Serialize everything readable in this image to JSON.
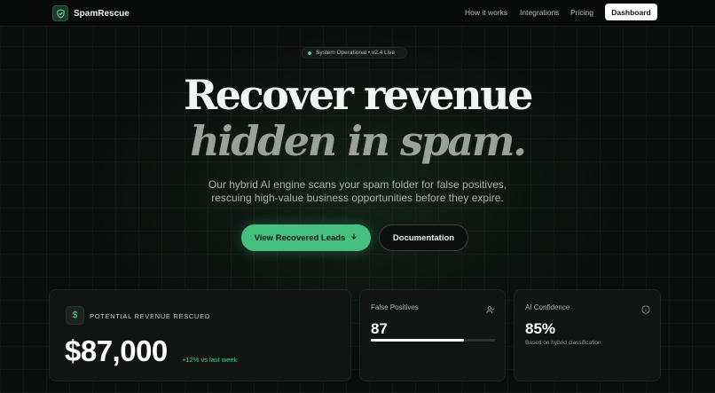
{
  "brand": {
    "name": "SpamRescue",
    "logo_icon": "shield-check-icon"
  },
  "nav": {
    "links": [
      "How it works",
      "Integrations",
      "Pricing"
    ],
    "cta": "Dashboard"
  },
  "hero": {
    "status": "System Operational • v2.4 Live",
    "title_line1": "Recover revenue",
    "title_line2": "hidden in spam.",
    "subtitle_line1": "Our hybrid AI engine scans your spam folder for false positives,",
    "subtitle_line2": "rescuing high-value business opportunities before they expire.",
    "primary_button": "View Recovered Leads",
    "primary_button_icon": "arrow-down-icon",
    "secondary_button": "Documentation"
  },
  "stats": {
    "revenue": {
      "icon": "dollar-icon",
      "label": "POTENTIAL REVENUE RESCUED",
      "value": "$87,000",
      "delta": "+12% vs last week"
    },
    "false_positives": {
      "title": "False Positives",
      "icon": "user-check-icon",
      "value": "87",
      "progress": 0.75
    },
    "ai_confidence": {
      "title": "AI Confidence",
      "icon": "info-icon",
      "value": "85%",
      "note": "Based on hybrid classification"
    }
  },
  "colors": {
    "accent": "#46c07e",
    "background": "#0b0d0c",
    "card": "#121413",
    "positive": "#4fd08a"
  }
}
